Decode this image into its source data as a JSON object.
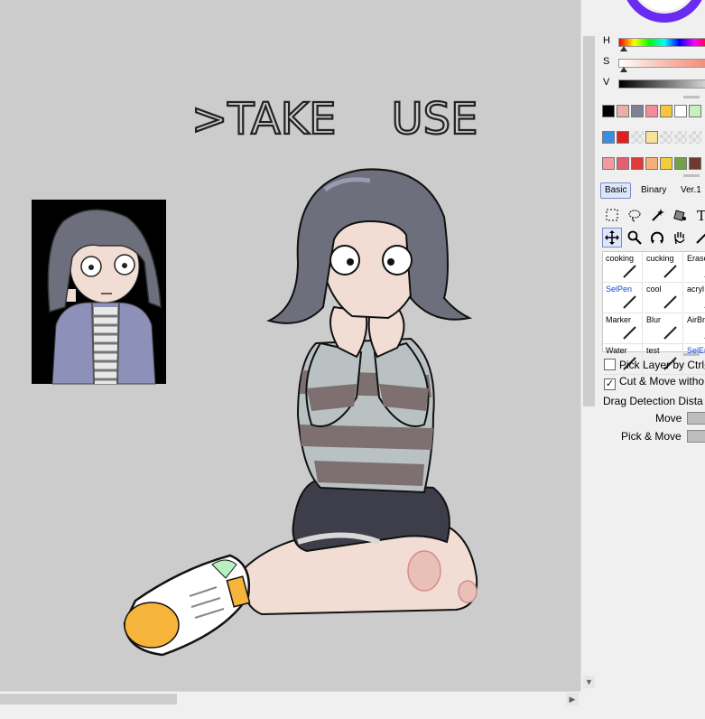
{
  "canvas": {
    "handwritten_text": ">TAKE    USE",
    "background_color": "#cccccc"
  },
  "color_panel": {
    "h_label": "H",
    "s_label": "S",
    "v_label": "V"
  },
  "swatches": {
    "row1": [
      "#000000",
      "#e9b0a6",
      "#7e8196",
      "#f48a9a",
      "#f7c43a",
      "#ffffff",
      "#c8f0c0"
    ],
    "row2": [
      "#3a8ee0",
      "#e0201e",
      "#eee",
      "#f7e29a",
      "#eee",
      "#eee",
      "#eee"
    ],
    "row3": [
      "#f39aa0",
      "#e06070",
      "#e03a3a",
      "#f4b07a",
      "#f2cc3a",
      "#74a04a",
      "#6e3a30"
    ]
  },
  "tool_tabs": [
    "Basic",
    "Binary",
    "Ver.1"
  ],
  "tools_row1": [
    "select-rect-icon",
    "lasso-icon",
    "magic-wand-icon",
    "fill-icon",
    "text-icon"
  ],
  "tools_row2": [
    "move-icon",
    "zoom-icon",
    "rotate-icon",
    "hand-icon",
    "dropper-icon"
  ],
  "brushes": [
    {
      "name": "cooking",
      "blue": false
    },
    {
      "name": "cucking",
      "blue": false
    },
    {
      "name": "Erase",
      "blue": false
    },
    {
      "name": "SelPen",
      "blue": true
    },
    {
      "name": "cool",
      "blue": false
    },
    {
      "name": "acryl",
      "blue": false
    },
    {
      "name": "Marker",
      "blue": false
    },
    {
      "name": "Blur",
      "blue": false
    },
    {
      "name": "AirBr",
      "blue": false
    },
    {
      "name": "Water",
      "blue": false
    },
    {
      "name": "test",
      "blue": false
    },
    {
      "name": "SelEr",
      "blue": true
    }
  ],
  "options": {
    "pick_layer": "Pick Layer by Ctrl+",
    "cut_move": "Cut & Move witho",
    "drag_detection": "Drag Detection Dista",
    "move_label": "Move",
    "pick_move_label": "Pick & Move"
  },
  "colors": {
    "accent": "#7a8cc4",
    "hair": "#6e6f7d",
    "skin": "#f1ddd3",
    "stripe_light": "#b9c1c2",
    "stripe_dark": "#7e7070",
    "shorts": "#3e3d4a",
    "sock": "#f6b43a",
    "hoodie": "#8d90b8"
  }
}
